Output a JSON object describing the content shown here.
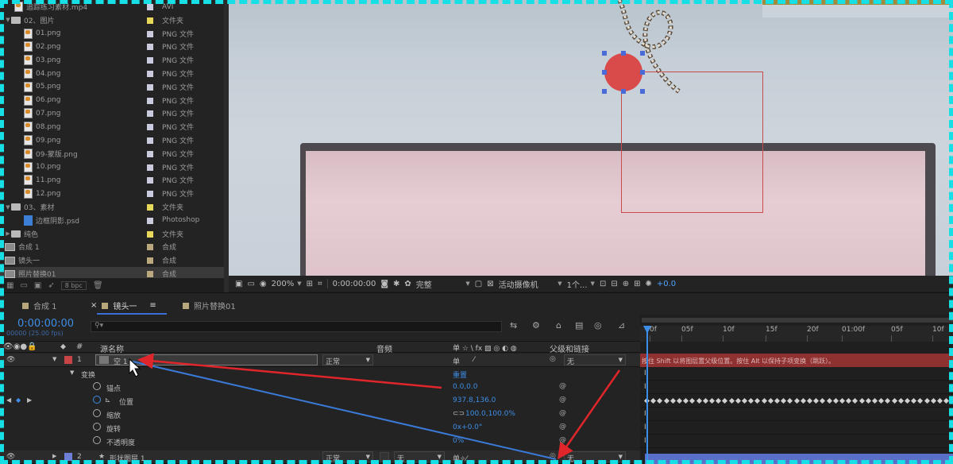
{
  "project": {
    "items": [
      {
        "name": "追踪练习素材.mp4",
        "type": "AVI",
        "icon": "video-icon",
        "swatch": "#cbcbe0",
        "indent": 1
      },
      {
        "name": "02、图片",
        "type": "文件夹",
        "icon": "folder-icon",
        "swatch": "#e8d85a",
        "indent": 0,
        "expanded": true
      },
      {
        "name": "01.png",
        "type": "PNG 文件",
        "icon": "png-icon",
        "swatch": "#cbcbe0",
        "indent": 2
      },
      {
        "name": "02.png",
        "type": "PNG 文件",
        "icon": "png-icon",
        "swatch": "#cbcbe0",
        "indent": 2
      },
      {
        "name": "03.png",
        "type": "PNG 文件",
        "icon": "png-icon",
        "swatch": "#cbcbe0",
        "indent": 2
      },
      {
        "name": "04.png",
        "type": "PNG 文件",
        "icon": "png-icon",
        "swatch": "#cbcbe0",
        "indent": 2
      },
      {
        "name": "05.png",
        "type": "PNG 文件",
        "icon": "png-icon",
        "swatch": "#cbcbe0",
        "indent": 2
      },
      {
        "name": "06.png",
        "type": "PNG 文件",
        "icon": "png-icon",
        "swatch": "#cbcbe0",
        "indent": 2
      },
      {
        "name": "07.png",
        "type": "PNG 文件",
        "icon": "png-icon",
        "swatch": "#cbcbe0",
        "indent": 2
      },
      {
        "name": "08.png",
        "type": "PNG 文件",
        "icon": "png-icon",
        "swatch": "#cbcbe0",
        "indent": 2
      },
      {
        "name": "09.png",
        "type": "PNG 文件",
        "icon": "png-icon",
        "swatch": "#cbcbe0",
        "indent": 2
      },
      {
        "name": "09-蒙版.png",
        "type": "PNG 文件",
        "icon": "png-icon",
        "swatch": "#cbcbe0",
        "indent": 2
      },
      {
        "name": "10.png",
        "type": "PNG 文件",
        "icon": "png-icon",
        "swatch": "#cbcbe0",
        "indent": 2
      },
      {
        "name": "11.png",
        "type": "PNG 文件",
        "icon": "png-icon",
        "swatch": "#cbcbe0",
        "indent": 2
      },
      {
        "name": "12.png",
        "type": "PNG 文件",
        "icon": "png-icon",
        "swatch": "#cbcbe0",
        "indent": 2
      },
      {
        "name": "03、素材",
        "type": "文件夹",
        "icon": "folder-icon",
        "swatch": "#e8d85a",
        "indent": 0,
        "expanded": true
      },
      {
        "name": "边框阴影.psd",
        "type": "Photoshop",
        "icon": "psd-icon",
        "swatch": "#cbcbe0",
        "indent": 2
      },
      {
        "name": "纯色",
        "type": "文件夹",
        "icon": "folder-icon",
        "swatch": "#e8d85a",
        "indent": 0
      },
      {
        "name": "合成 1",
        "type": "合成",
        "icon": "comp-icon",
        "swatch": "#b9a97c",
        "indent": 0
      },
      {
        "name": "镜头一",
        "type": "合成",
        "icon": "comp-icon",
        "swatch": "#b9a97c",
        "indent": 0
      },
      {
        "name": "照片替换01",
        "type": "合成",
        "icon": "comp-icon",
        "swatch": "#b9a97c",
        "indent": 0,
        "selected": true
      }
    ],
    "bpc": "8 bpc"
  },
  "viewer_toolbar": {
    "zoom": "200%",
    "timecode": "0:00:00:00",
    "resolution": "完整",
    "camera": "活动摄像机",
    "views": "1个...",
    "exposure": "+0.0"
  },
  "timeline": {
    "tabs": [
      {
        "label": "合成 1",
        "active": false
      },
      {
        "label": "镜头一",
        "active": true
      },
      {
        "label": "照片替换01",
        "active": false
      }
    ],
    "timecode": "0:00:00:00",
    "fps": "00000 (25.00 fps)",
    "columns": {
      "source_name": "源名称",
      "audio": "音频",
      "switches": "单 ☆ \\ fx ▨ ◎ ◐ ◍",
      "parent": "父级和链接"
    },
    "layers": [
      {
        "index": "1",
        "name": "空 1",
        "mode": "正常",
        "parent": "无",
        "color": "#c94545"
      },
      {
        "index": "2",
        "name": "形状图层 1",
        "mode": "正常",
        "trkmat": "无",
        "parent": "无",
        "color": "#6e7fd8"
      }
    ],
    "transform": {
      "label": "变换",
      "reset": "重置",
      "props": [
        {
          "name": "锚点",
          "value": "0.0,0.0"
        },
        {
          "name": "位置",
          "value": "937.8,136.0"
        },
        {
          "name": "缩放",
          "value": "100.0,100.0%"
        },
        {
          "name": "旋转",
          "value": "0x+0.0°"
        },
        {
          "name": "不透明度",
          "value": "0%"
        }
      ]
    },
    "ruler": [
      "0f",
      "05f",
      "10f",
      "15f",
      "20f",
      "01:00f",
      "05f",
      "10f"
    ],
    "hint": "按住 Shift 以将图层置父级位置。按住 Alt 以保持子项变换（跳跃）。"
  },
  "colors": {
    "accent": "#3d8ee6",
    "frame": "#16e0e6",
    "arrow": "#e0262b"
  }
}
